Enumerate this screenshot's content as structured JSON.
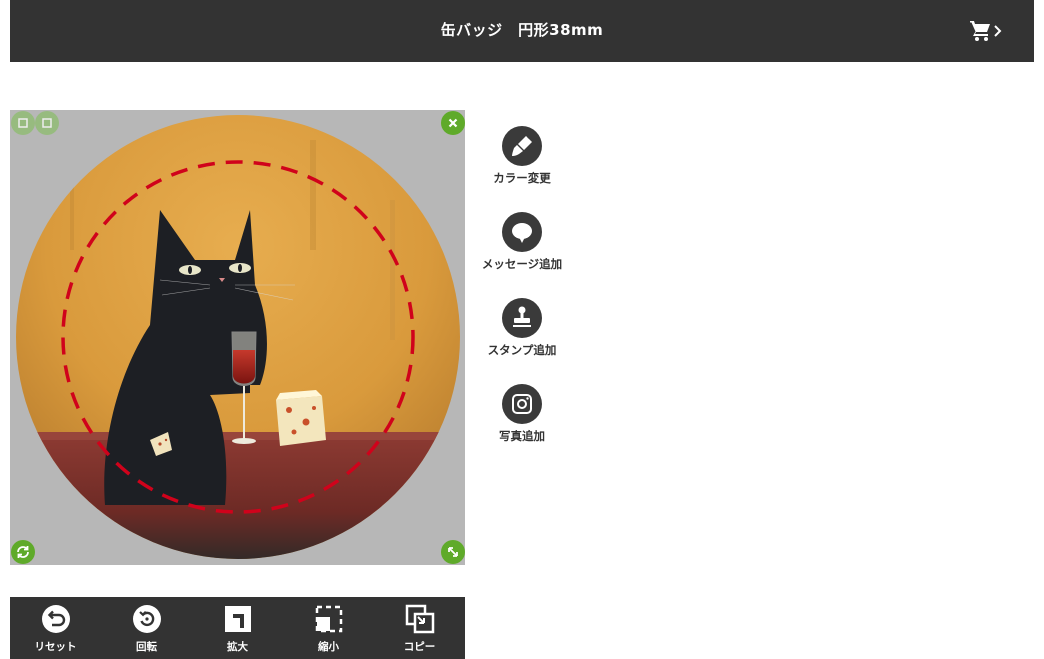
{
  "header": {
    "title": "缶バッジ　円形38mm",
    "cart_icon": "cart-icon",
    "next_icon": "chevron-right-icon"
  },
  "canvas": {
    "background_color": "#b7b7b7",
    "guide_color": "#d0021b",
    "handle_color": "#5faa2a",
    "image_description_icon": "cat-wine-cheese-artwork"
  },
  "tools": [
    {
      "label": "カラー変更",
      "icon": "paint-brush-icon"
    },
    {
      "label": "メッセージ追加",
      "icon": "speech-bubble-icon"
    },
    {
      "label": "スタンプ追加",
      "icon": "stamp-icon"
    },
    {
      "label": "写真追加",
      "icon": "camera-icon"
    }
  ],
  "toolbar": [
    {
      "label": "リセット",
      "icon": "reset-icon"
    },
    {
      "label": "回転",
      "icon": "rotate-icon"
    },
    {
      "label": "拡大",
      "icon": "enlarge-icon"
    },
    {
      "label": "縮小",
      "icon": "shrink-icon"
    },
    {
      "label": "コピー",
      "icon": "copy-icon"
    }
  ]
}
